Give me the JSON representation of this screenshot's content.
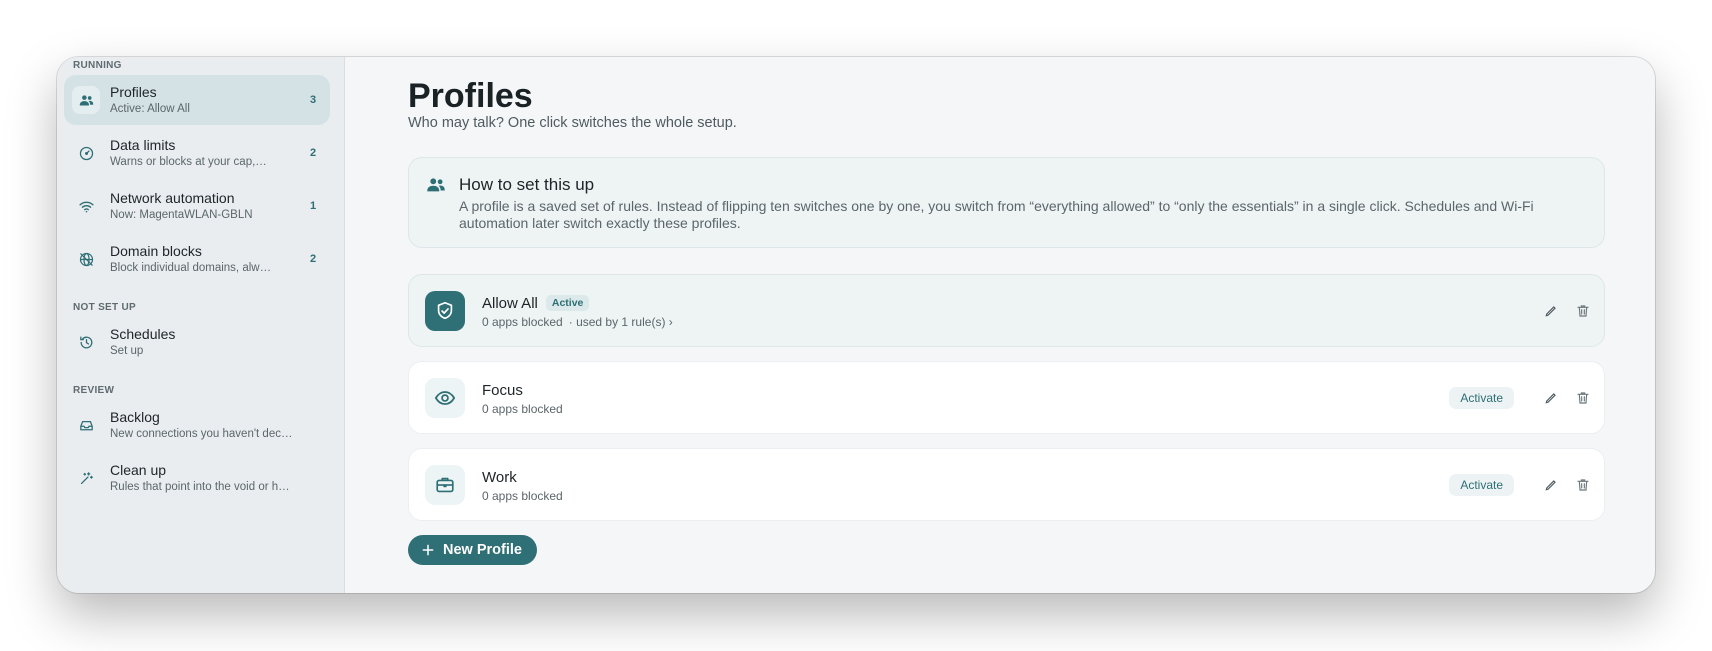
{
  "sidebar": {
    "sections": [
      {
        "label": "RUNNING"
      },
      {
        "label": "NOT SET UP"
      },
      {
        "label": "REVIEW"
      }
    ],
    "items": [
      {
        "title": "Profiles",
        "subtitle": "Active: Allow All",
        "count": "3",
        "icon": "people-icon"
      },
      {
        "title": "Data limits",
        "subtitle": "Warns or blocks at your cap,…",
        "count": "2",
        "icon": "gauge-icon"
      },
      {
        "title": "Network automation",
        "subtitle": "Now: MagentaWLAN-GBLN",
        "count": "1",
        "icon": "wifi-icon"
      },
      {
        "title": "Domain blocks",
        "subtitle": "Block individual domains, alw…",
        "count": "2",
        "icon": "globe-block-icon"
      },
      {
        "title": "Schedules",
        "subtitle": "Set up",
        "count": "",
        "icon": "clock-history-icon"
      },
      {
        "title": "Backlog",
        "subtitle": "New connections you haven't dec…",
        "count": "",
        "icon": "inbox-icon"
      },
      {
        "title": "Clean up",
        "subtitle": "Rules that point into the void or h…",
        "count": "",
        "icon": "magic-wand-icon"
      }
    ]
  },
  "main": {
    "title": "Profiles",
    "subtitle": "Who may talk? One click switches the whole setup.",
    "help": {
      "title": "How to set this up",
      "text": "A profile is a saved set of rules. Instead of flipping ten switches one by one, you switch from “everything allowed” to “only the essentials” in a single click. Schedules and Wi-Fi automation later switch exactly these profiles."
    },
    "profiles": [
      {
        "name": "Allow All",
        "badge": "Active",
        "meta": "0 apps blocked",
        "link": "· used by 1 rule(s)",
        "icon": "shield-check-icon",
        "active": true
      },
      {
        "name": "Focus",
        "meta": "0 apps blocked",
        "action": "Activate",
        "icon": "eye-icon",
        "active": false
      },
      {
        "name": "Work",
        "meta": "0 apps blocked",
        "action": "Activate",
        "icon": "briefcase-icon",
        "active": false
      }
    ],
    "new_button": "New Profile"
  },
  "colors": {
    "accent": "#2f6f76",
    "sidebar_bg": "#e9edf0",
    "active_item_bg": "#d5e2e5",
    "main_bg": "#f4f6f8"
  }
}
